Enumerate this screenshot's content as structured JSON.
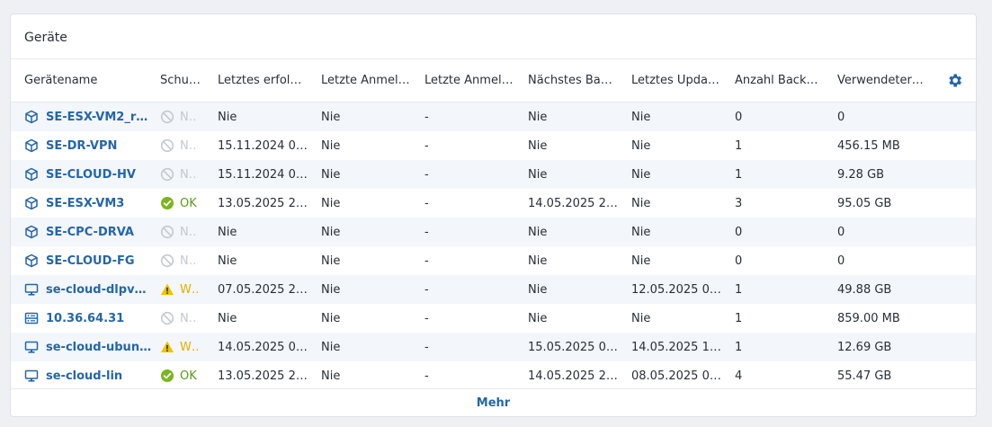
{
  "card": {
    "title": "Geräte"
  },
  "columns": [
    "Gerätename",
    "Schu…",
    "Letztes erfol…",
    "Letzte Anmel…",
    "Letzte Anmel…",
    "Nächstes Ba…",
    "Letztes Upda…",
    "Anzahl Back…",
    "Verwendeter…"
  ],
  "settings_icon": "gear-icon",
  "colors": {
    "link": "#2566a8",
    "ok": "#7ab51d",
    "warning": "#f2c200",
    "neutral": "#c4c9cf",
    "stripe": "#f3f6fb"
  },
  "rows": [
    {
      "name": "SE-ESX-VM2_re…",
      "icon": "vm-cube-icon",
      "status": "N…",
      "status_type": "none",
      "last_success": "Nie",
      "last_login1": "Nie",
      "last_login2": "-",
      "next_backup": "Nie",
      "last_update": "Nie",
      "backup_count": "0",
      "used": "0"
    },
    {
      "name": "SE-DR-VPN",
      "icon": "vm-cube-icon",
      "status": "N…",
      "status_type": "none",
      "last_success": "15.11.2024 0…",
      "last_login1": "Nie",
      "last_login2": "-",
      "next_backup": "Nie",
      "last_update": "Nie",
      "backup_count": "1",
      "used": "456.15 MB"
    },
    {
      "name": "SE-CLOUD-HV",
      "icon": "vm-cube-icon",
      "status": "N…",
      "status_type": "none",
      "last_success": "15.11.2024 0…",
      "last_login1": "Nie",
      "last_login2": "-",
      "next_backup": "Nie",
      "last_update": "Nie",
      "backup_count": "1",
      "used": "9.28 GB"
    },
    {
      "name": "SE-ESX-VM3",
      "icon": "vm-cube-icon",
      "status": "OK",
      "status_type": "ok",
      "last_success": "13.05.2025 2…",
      "last_login1": "Nie",
      "last_login2": "-",
      "next_backup": "14.05.2025 2…",
      "last_update": "Nie",
      "backup_count": "3",
      "used": "95.05 GB"
    },
    {
      "name": "SE-CPC-DRVA",
      "icon": "vm-cube-icon",
      "status": "N…",
      "status_type": "none",
      "last_success": "Nie",
      "last_login1": "Nie",
      "last_login2": "-",
      "next_backup": "Nie",
      "last_update": "Nie",
      "backup_count": "0",
      "used": "0"
    },
    {
      "name": "SE-CLOUD-FG",
      "icon": "vm-cube-icon",
      "status": "N…",
      "status_type": "none",
      "last_success": "Nie",
      "last_login1": "Nie",
      "last_login2": "-",
      "next_backup": "Nie",
      "last_update": "Nie",
      "backup_count": "0",
      "used": "0"
    },
    {
      "name": "se-cloud-dlpv…",
      "icon": "monitor-icon",
      "status": "W…",
      "status_type": "warning",
      "last_success": "07.05.2025 2…",
      "last_login1": "Nie",
      "last_login2": "-",
      "next_backup": "Nie",
      "last_update": "12.05.2025 0…",
      "backup_count": "1",
      "used": "49.88 GB"
    },
    {
      "name": "10.36.64.31",
      "icon": "server-icon",
      "status": "N…",
      "status_type": "none",
      "last_success": "Nie",
      "last_login1": "Nie",
      "last_login2": "-",
      "next_backup": "Nie",
      "last_update": "Nie",
      "backup_count": "1",
      "used": "859.00 MB"
    },
    {
      "name": "se-cloud-ubun…",
      "icon": "monitor-icon",
      "status": "W…",
      "status_type": "warning",
      "last_success": "14.05.2025 0…",
      "last_login1": "Nie",
      "last_login2": "-",
      "next_backup": "15.05.2025 0…",
      "last_update": "14.05.2025 1…",
      "backup_count": "1",
      "used": "12.69 GB"
    },
    {
      "name": "se-cloud-lin",
      "icon": "monitor-icon",
      "status": "OK",
      "status_type": "ok",
      "last_success": "13.05.2025 2…",
      "last_login1": "Nie",
      "last_login2": "-",
      "next_backup": "14.05.2025 2…",
      "last_update": "08.05.2025 0…",
      "backup_count": "4",
      "used": "55.47 GB"
    }
  ],
  "more_label": "Mehr"
}
